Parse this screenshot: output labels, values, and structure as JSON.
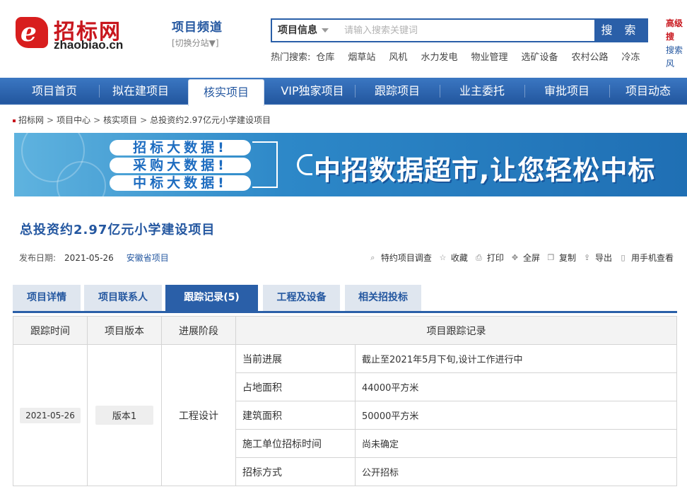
{
  "header": {
    "logo_cn": "招标网",
    "logo_en": "zhaobiao.cn",
    "channel_title": "项目频道",
    "channel_switch": "[切换分站▼]",
    "search_category": "项目信息",
    "search_placeholder": "请输入搜索关键词",
    "search_button": "搜 索",
    "hot_label": "热门搜索:",
    "hot_keywords": [
      "仓库",
      "烟草站",
      "风机",
      "水力发电",
      "物业管理",
      "选矿设备",
      "农村公路",
      "冷冻"
    ],
    "advanced_search": "高级搜",
    "search_more": "搜索风"
  },
  "nav": {
    "items": [
      "项目首页",
      "拟在建项目",
      "核实项目",
      "VIP独家项目",
      "跟踪项目",
      "业主委托",
      "审批项目",
      "项目动态"
    ],
    "active_index": 2
  },
  "breadcrumb": [
    "招标网",
    "项目中心",
    "核实项目",
    "总投资约2.97亿元小学建设项目"
  ],
  "banner": {
    "pills": [
      "招标大数据!",
      "采购大数据!",
      "中标大数据!"
    ],
    "slogan": "中招数据超市,让您轻松中标"
  },
  "project": {
    "title": "总投资约2.97亿元小学建设项目",
    "date_label": "发布日期:",
    "date": "2021-05-26",
    "province": "安徽省项目"
  },
  "tools": [
    {
      "icon": "magnifier-icon",
      "label": "特约项目调查"
    },
    {
      "icon": "star-icon",
      "label": "收藏"
    },
    {
      "icon": "printer-icon",
      "label": "打印"
    },
    {
      "icon": "fullscreen-icon",
      "label": "全屏"
    },
    {
      "icon": "copy-icon",
      "label": "复制"
    },
    {
      "icon": "export-icon",
      "label": "导出"
    },
    {
      "icon": "mobile-icon",
      "label": "用手机查看"
    }
  ],
  "tabs": [
    "项目详情",
    "项目联系人",
    "跟踪记录(5)",
    "工程及设备",
    "相关招投标"
  ],
  "active_tab": 2,
  "table": {
    "headers": [
      "跟踪时间",
      "项目版本",
      "进展阶段",
      "项目跟踪记录"
    ],
    "track_time": "2021-05-26",
    "version": "版本1",
    "stage": "工程设计",
    "records": [
      {
        "label": "当前进展",
        "value": "截止至2021年5月下旬,设计工作进行中"
      },
      {
        "label": "占地面积",
        "value": "44000平方米"
      },
      {
        "label": "建筑面积",
        "value": "50000平方米"
      },
      {
        "label": "施工单位招标时间",
        "value": "尚未确定"
      },
      {
        "label": "招标方式",
        "value": "公开招标"
      }
    ]
  },
  "colors": {
    "brand_red": "#c8161d",
    "primary_blue": "#2a5fa8",
    "link_blue": "#2457a0"
  }
}
